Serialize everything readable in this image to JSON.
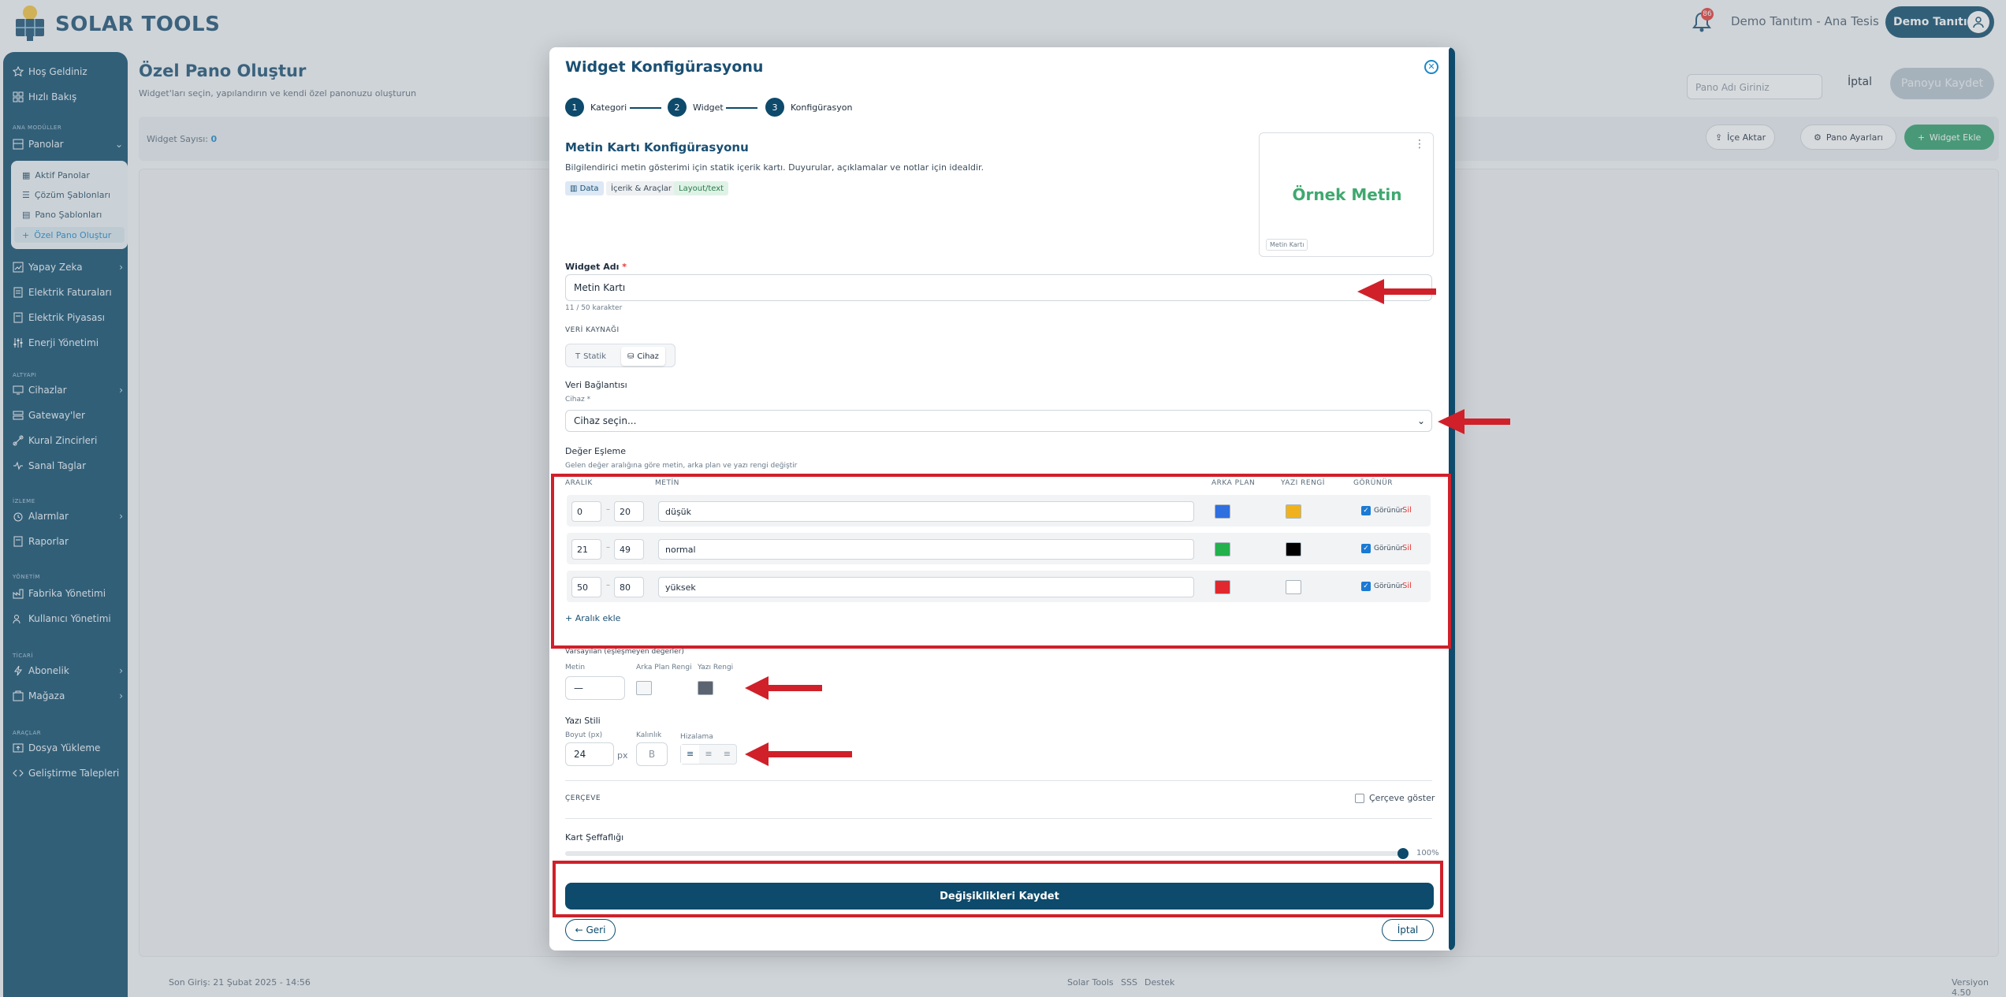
{
  "app": {
    "brand": "SOLAR TOOLS",
    "notif_count": "86",
    "org": "Demo Tanıtım - Ana Tesis",
    "user": "Demo Tanıtım"
  },
  "sidebar": {
    "top": [
      {
        "label": "Hoş Geldiniz"
      },
      {
        "label": "Hızlı Bakış"
      }
    ],
    "sec_ana": "ANA MODÜLLER",
    "panolar": "Panolar",
    "sub": [
      {
        "label": "Aktif Panolar"
      },
      {
        "label": "Çözüm Şablonları"
      },
      {
        "label": "Pano Şablonları"
      },
      {
        "label": "Özel Pano Oluştur"
      }
    ],
    "mid": [
      {
        "label": "Yapay Zeka"
      },
      {
        "label": "Elektrik Faturaları"
      },
      {
        "label": "Elektrik Piyasası"
      },
      {
        "label": "Enerji Yönetimi"
      }
    ],
    "sec_altyapi": "ALTYAPI",
    "altyapi": [
      {
        "label": "Cihazlar"
      },
      {
        "label": "Gateway'ler"
      },
      {
        "label": "Kural Zincirleri"
      },
      {
        "label": "Sanal Taglar"
      }
    ],
    "sec_izleme": "İZLEME",
    "izleme": [
      {
        "label": "Alarmlar"
      },
      {
        "label": "Raporlar"
      }
    ],
    "sec_yonetim": "YÖNETİM",
    "yonetim": [
      {
        "label": "Fabrika Yönetimi"
      },
      {
        "label": "Kullanıcı Yönetimi"
      }
    ],
    "sec_ticari": "TİCARİ",
    "ticari": [
      {
        "label": "Abonelik"
      },
      {
        "label": "Mağaza"
      }
    ],
    "sec_araclar": "ARAÇLAR",
    "araclar": [
      {
        "label": "Dosya Yükleme"
      },
      {
        "label": "Geliştirme Talepleri"
      }
    ]
  },
  "page": {
    "title": "Özel Pano Oluştur",
    "subtitle": "Widget'ları seçin, yapılandırın ve kendi özel panonuzu oluşturun",
    "name_placeholder": "Pano Adı Giriniz",
    "cancel": "İptal",
    "save": "Panoyu Kaydet",
    "widget_count_label": "Widget Sayısı:",
    "widget_count": "0",
    "import": "İçe Aktar",
    "settings": "Pano Ayarları",
    "add_widget": "Widget Ekle"
  },
  "footer": {
    "last_login": "Son Giriş: 21 Şubat 2025 - 14:56",
    "links": [
      "Solar Tools",
      "SSS",
      "Destek"
    ],
    "version": "Versiyon 4.50"
  },
  "modal": {
    "title": "Widget Konfigürasyonu",
    "steps": [
      {
        "n": "1",
        "label": "Kategori"
      },
      {
        "n": "2",
        "label": "Widget"
      },
      {
        "n": "3",
        "label": "Konfigürasyon"
      }
    ],
    "section_title": "Metin Kartı Konfigürasyonu",
    "section_desc": "Bilgilendirici metin gösterimi için statik içerik kartı. Duyurular, açıklamalar ve notlar için idealdir.",
    "tags": [
      "Data",
      "İçerik & Araçlar",
      "Layout/text"
    ],
    "preview_text": "Örnek Metin",
    "preview_badge": "Metin Kartı",
    "widget_name_label": "Widget Adı",
    "widget_name_value": "Metin Kartı",
    "widget_name_counter": "11 / 50 karakter",
    "data_source_label": "VERİ KAYNAĞI",
    "ds_static": "Statik",
    "ds_device": "Cihaz",
    "data_conn_label": "Veri Bağlantısı",
    "device_label": "Cihaz",
    "device_placeholder": "Cihaz seçin...",
    "mapping_label": "Değer Eşleme",
    "mapping_desc": "Gelen değer aralığına göre metin, arka plan ve yazı rengi değiştir",
    "headers": {
      "range": "ARALIK",
      "text": "METİN",
      "bg": "ARKA PLAN",
      "fg": "YAZI RENGİ",
      "visible": "GÖRÜNÜR"
    },
    "rows": [
      {
        "min": "0",
        "max": "20",
        "text": "düşük",
        "bg": "#2f6fe0",
        "fg": "#f0b21c",
        "visible": "Görünür",
        "del": "Sil"
      },
      {
        "min": "21",
        "max": "49",
        "text": "normal",
        "bg": "#22b14c",
        "fg": "#000000",
        "visible": "Görünür",
        "del": "Sil"
      },
      {
        "min": "50",
        "max": "80",
        "text": "yüksek",
        "bg": "#e0282e",
        "fg": "#ffffff",
        "visible": "Görünür",
        "del": "Sil"
      }
    ],
    "add_range": "+ Aralık ekle",
    "defaults_label": "Varsayılan (eşleşmeyen değerler)",
    "def_text_label": "Metin",
    "def_text_value": "—",
    "def_bg_label": "Arka Plan Rengi",
    "def_fg_label": "Yazı Rengi",
    "def_bg": "#f4f6f8",
    "def_fg": "#5b6470",
    "style_label": "Yazı Stili",
    "size_label": "Boyut (px)",
    "size_value": "24",
    "size_unit": "px",
    "weight_label": "Kalınlık",
    "weight_btn": "B",
    "align_label": "Hizalama",
    "frame_label": "ÇERÇEVE",
    "frame_show": "Çerçeve göster",
    "opacity_label": "Kart Şeffaflığı",
    "opacity_value": "100%",
    "save": "Değişiklikleri Kaydet",
    "back": "← Geri",
    "cancel": "İptal"
  }
}
